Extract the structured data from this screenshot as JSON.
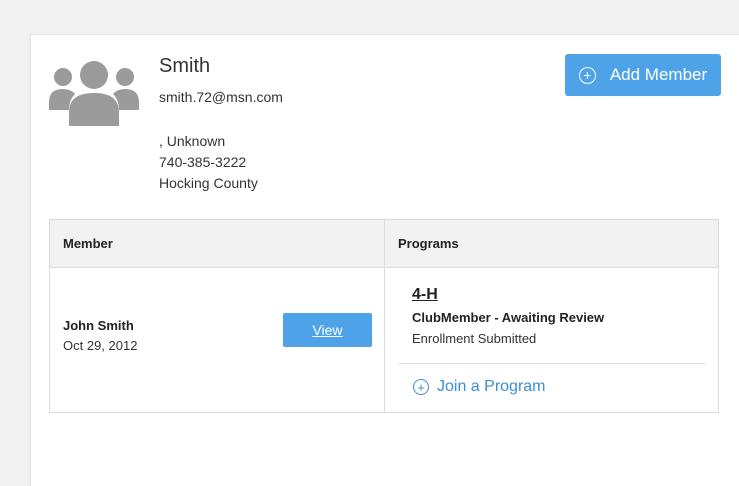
{
  "family": {
    "name": "Smith",
    "email": "smith.72@msn.com",
    "address_line": ", Unknown",
    "phone": "740-385-3222",
    "county": "Hocking County"
  },
  "actions": {
    "add_member_label": "Add Member",
    "plus_glyph": "+"
  },
  "table": {
    "headers": {
      "member": "Member",
      "programs": "Programs"
    },
    "rows": [
      {
        "member_name": "John Smith",
        "member_date": "Oct 29, 2012",
        "view_label": "View",
        "program": {
          "name": "4-H",
          "status": "ClubMember - Awaiting Review",
          "sub_status": "Enrollment Submitted"
        },
        "join_label": "Join a Program"
      }
    ]
  },
  "colors": {
    "accent": "#4ea3e8",
    "link": "#3a8fd8",
    "avatar_gray": "#9b9b9b"
  },
  "icons": {
    "avatar": "family-group-icon",
    "add": "plus-circle-icon"
  }
}
